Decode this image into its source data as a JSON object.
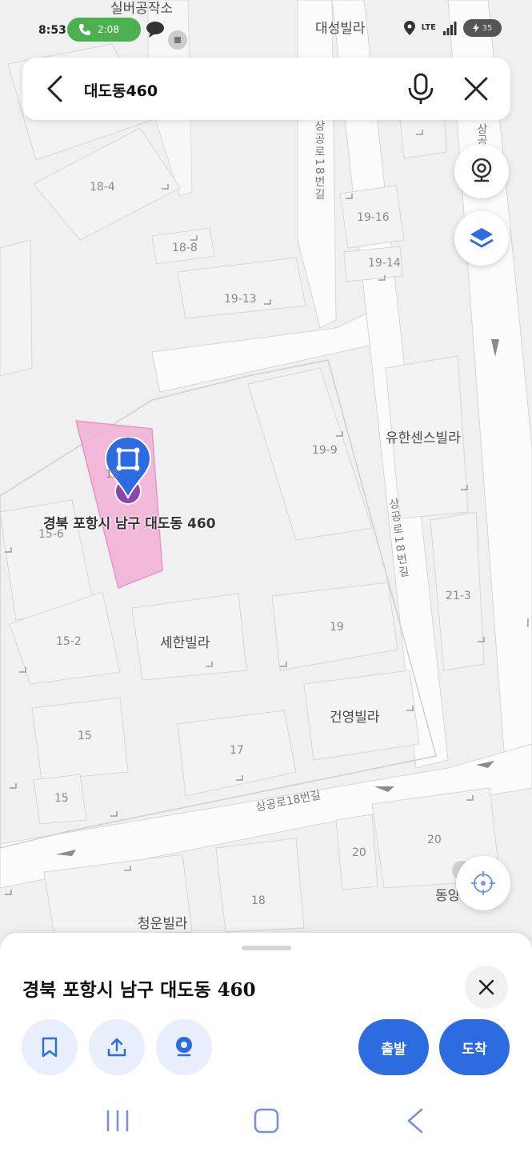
{
  "status_bar": {
    "time": "8:53",
    "call_timer": "2:08",
    "network": "LTE",
    "battery": "35"
  },
  "search": {
    "query": "대도동460"
  },
  "map": {
    "pin_caption": "경북 포항시 남구 대도동 460",
    "pin_parcel": "15",
    "labels": {
      "silver_workshop": "실버공작소",
      "daesung_villa": "대성빌라",
      "parcel_18_4": "18-4",
      "parcel_18_8": "18-8",
      "parcel_19_13": "19-13",
      "parcel_19_16": "19-16",
      "parcel_19_14": "19-14",
      "parcel_19_9": "19-9",
      "yuhan_sense_villa": "유한센스빌라",
      "parcel_15_6": "15-6",
      "parcel_21_3": "21-3",
      "parcel_15_2": "15-2",
      "sehan_villa": "세한빌라",
      "parcel_19": "19",
      "geonyoung_villa": "건영빌라",
      "parcel_15_a": "15",
      "parcel_17": "17",
      "parcel_15_b": "15",
      "road_sanggong_18_horizontal": "상공로18번길",
      "road_sanggong_18_vertical_top": "상공로18번길",
      "road_sanggong_18_vertical_mid": "상공로18번길",
      "road_sang_edge": "상공",
      "parcel_20_a": "20",
      "parcel_20_b": "20",
      "dong_edge": "동양",
      "cheongun_villa": "청운빌라",
      "parcel_18": "18",
      "edge_l": "l"
    }
  },
  "sheet": {
    "title": "경북 포항시 남구 대도동 460",
    "depart_label": "출발",
    "arrive_label": "도착"
  },
  "colors": {
    "accent": "#2c6be0",
    "parcel_highlight": "#f3b3d8",
    "call_green": "#4cb050"
  }
}
